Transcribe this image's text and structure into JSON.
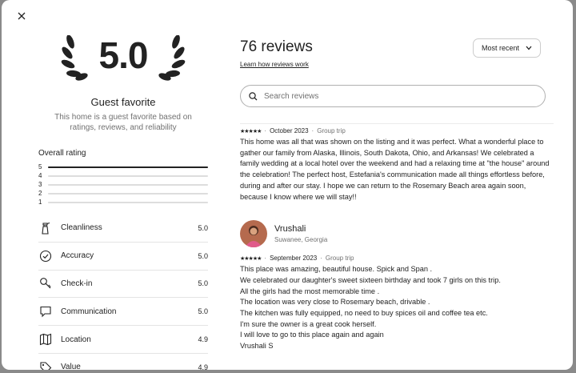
{
  "modal": {
    "close_label": "close"
  },
  "summary": {
    "score": "5.0",
    "title": "Guest favorite",
    "description": "This home is a guest favorite based on ratings, reviews, and reliability",
    "overall_label": "Overall rating",
    "distribution": [
      {
        "stars": "5",
        "fraction": 1.0
      },
      {
        "stars": "4",
        "fraction": 0.0
      },
      {
        "stars": "3",
        "fraction": 0.0
      },
      {
        "stars": "2",
        "fraction": 0.0
      },
      {
        "stars": "1",
        "fraction": 0.0
      }
    ],
    "categories": [
      {
        "label": "Cleanliness",
        "value": "5.0",
        "icon": "spray-bottle-icon"
      },
      {
        "label": "Accuracy",
        "value": "5.0",
        "icon": "check-circle-icon"
      },
      {
        "label": "Check-in",
        "value": "5.0",
        "icon": "key-icon"
      },
      {
        "label": "Communication",
        "value": "5.0",
        "icon": "message-bubble-icon"
      },
      {
        "label": "Location",
        "value": "4.9",
        "icon": "map-icon"
      },
      {
        "label": "Value",
        "value": "4.9",
        "icon": "tag-icon"
      }
    ]
  },
  "reviews_header": {
    "count_label": "76 reviews",
    "learn_link": "Learn how reviews work",
    "sort_label": "Most recent"
  },
  "search": {
    "placeholder": "Search reviews"
  },
  "reviews": [
    {
      "stars": "★★★★★",
      "date": "October 2023",
      "trip": "Group trip",
      "text": "This home was all that was shown on the listing and it was perfect. What a wonderful place to gather our family from Alaska, Illinois, South Dakota, Ohio, and Arkansas! We celebrated a family wedding at a local hotel over the weekend and had a relaxing time at \"the house\" around the celebration! The perfect host, Estefania's communication made all things effortless before, during and after our stay. I hope we can return to the Rosemary Beach area again soon, because I know where we will stay!!"
    },
    {
      "name": "Vrushali",
      "location": "Suwanee, Georgia",
      "stars": "★★★★★",
      "date": "September 2023",
      "trip": "Group trip",
      "text": "This place was amazing, beautiful house. Spick and Span .\nWe celebrated our daughter's sweet sixteen birthday and took 7 girls on this trip.\nAll the girls had the most memorable time .\nThe location was very close to Rosemary beach, drivable .\nThe kitchen was fully equipped, no need to buy spices oil and coffee tea etc.\nI'm sure the owner is a great cook herself.\nI will love to go to this place again and again\nVrushali S"
    }
  ]
}
